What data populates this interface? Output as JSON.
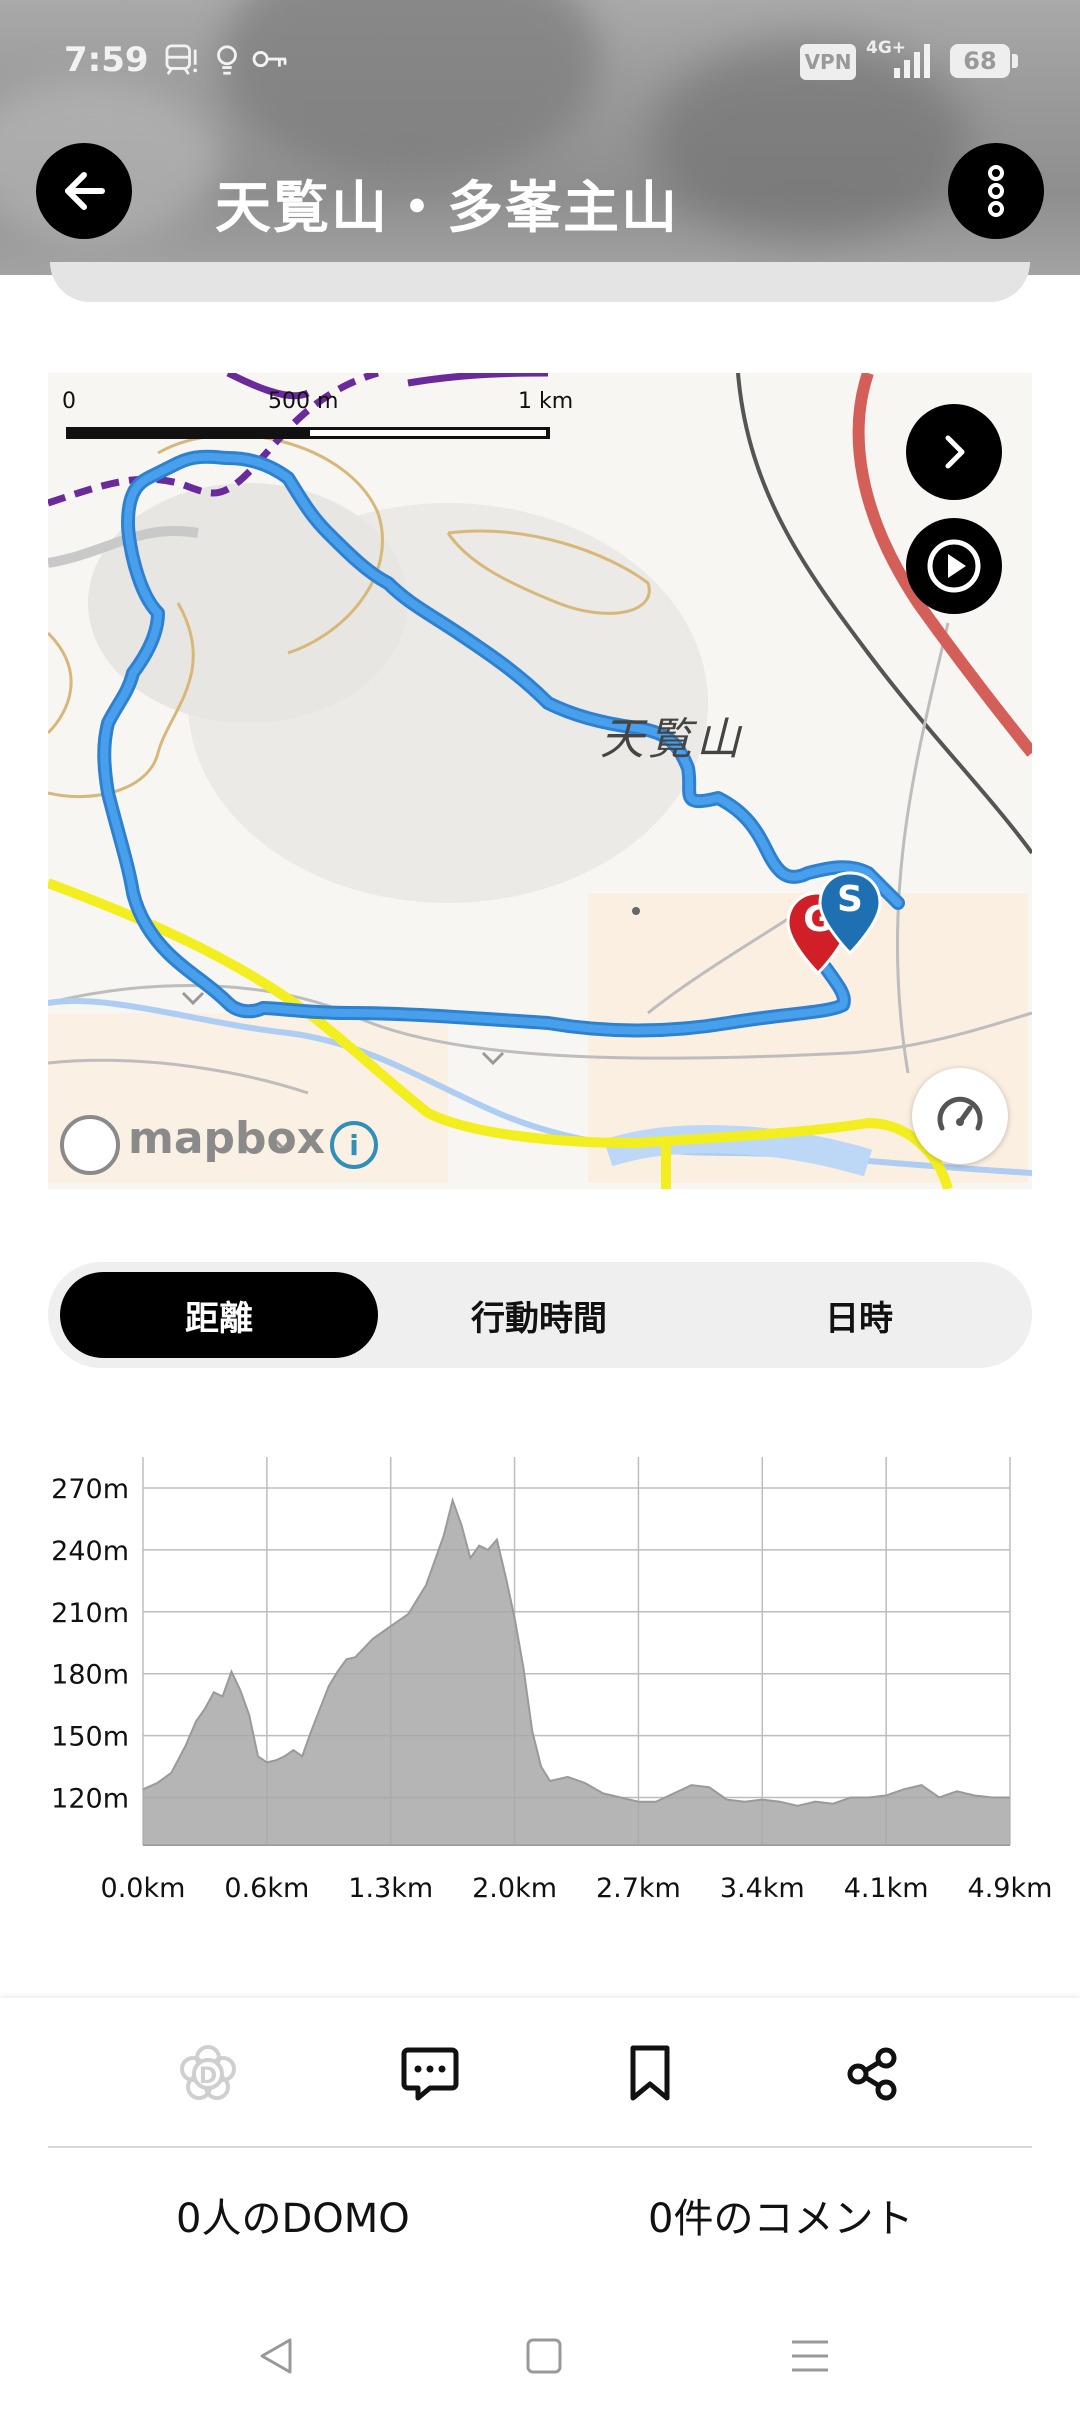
{
  "status_bar": {
    "time": "7:59",
    "vpn": "VPN",
    "network": "4G+",
    "battery": "68"
  },
  "header": {
    "title": "天覧山・多峯主山",
    "back_icon": "arrow-left-icon",
    "menu_icon": "more-vertical-icon"
  },
  "map": {
    "scale_labels": [
      "0",
      "500 m",
      "1 km"
    ],
    "place_label": "天覧山",
    "start_marker": "S",
    "goal_marker": "G",
    "attribution": "mapbox",
    "route_color": "#3a8fdc",
    "buttons": {
      "next_icon": "chevron-right-icon",
      "play_icon": "play-circle-icon",
      "speed_icon": "speedometer-icon",
      "info_icon": "info-icon"
    }
  },
  "tabs": {
    "items": [
      {
        "label": "距離",
        "selected": true
      },
      {
        "label": "行動時間",
        "selected": false
      },
      {
        "label": "日時",
        "selected": false
      }
    ]
  },
  "chart_data": {
    "type": "area",
    "title": "",
    "xlabel": "",
    "ylabel": "",
    "x_tick_labels": [
      "0.0km",
      "0.6km",
      "1.3km",
      "2.0km",
      "2.7km",
      "3.4km",
      "4.1km",
      "4.9km"
    ],
    "y_tick_labels": [
      "270m",
      "240m",
      "210m",
      "180m",
      "150m",
      "120m"
    ],
    "xlim": [
      0,
      4.9
    ],
    "ylim": [
      97,
      285
    ],
    "grid": true,
    "x": [
      0.0,
      0.08,
      0.16,
      0.24,
      0.3,
      0.35,
      0.4,
      0.45,
      0.5,
      0.55,
      0.6,
      0.65,
      0.7,
      0.75,
      0.8,
      0.85,
      0.9,
      0.95,
      1.0,
      1.05,
      1.1,
      1.15,
      1.2,
      1.3,
      1.4,
      1.5,
      1.6,
      1.7,
      1.75,
      1.8,
      1.85,
      1.9,
      1.95,
      2.0,
      2.05,
      2.1,
      2.15,
      2.2,
      2.25,
      2.3,
      2.4,
      2.5,
      2.6,
      2.7,
      2.8,
      2.9,
      3.0,
      3.1,
      3.2,
      3.3,
      3.4,
      3.5,
      3.6,
      3.7,
      3.8,
      3.9,
      4.0,
      4.1,
      4.2,
      4.3,
      4.4,
      4.5,
      4.6,
      4.7,
      4.8,
      4.9
    ],
    "values": [
      124,
      127,
      132,
      145,
      157,
      163,
      171,
      169,
      181,
      172,
      160,
      140,
      137,
      138,
      140,
      143,
      140,
      152,
      163,
      174,
      181,
      187,
      188,
      197,
      203,
      209,
      223,
      247,
      264,
      252,
      236,
      242,
      240,
      245,
      227,
      207,
      183,
      152,
      135,
      128,
      130,
      127,
      122,
      120,
      118,
      118,
      122,
      126,
      125,
      119,
      118,
      119,
      118,
      116,
      118,
      117,
      120,
      120,
      121,
      124,
      126,
      120,
      123,
      121,
      120,
      120
    ],
    "fill_color": "#a8a8a8"
  },
  "actions": {
    "domo_icon": "domo-flower-icon",
    "comment_icon": "comment-icon",
    "bookmark_icon": "bookmark-icon",
    "share_icon": "share-icon",
    "domo_count": "0人のDOMO",
    "comment_count": "0件のコメント"
  },
  "nav_bar": {
    "back_icon": "nav-back-icon",
    "home_icon": "nav-home-icon",
    "menu_icon": "nav-menu-icon"
  }
}
